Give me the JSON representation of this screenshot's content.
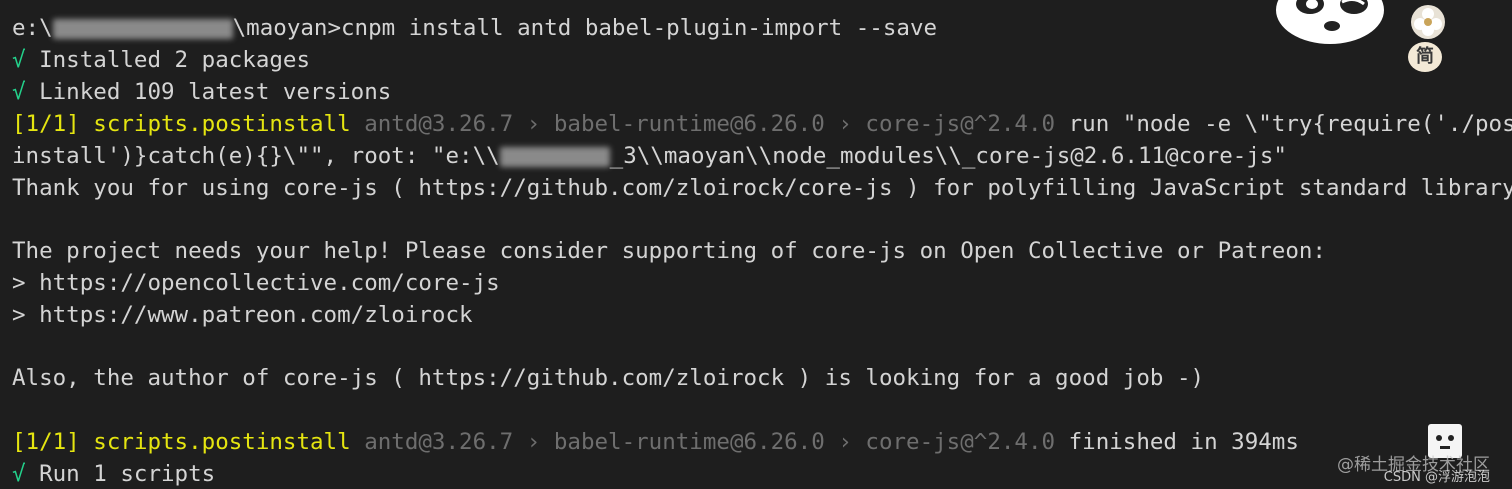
{
  "terminal": {
    "line1": {
      "prefix": "e:\\",
      "suffix": "\\maoyan>cnpm install antd babel-plugin-import --save"
    },
    "line2": {
      "check": "√",
      "text": " Installed 2 packages"
    },
    "line3": {
      "check": "√",
      "text": " Linked 109 latest versions"
    },
    "line4": {
      "tag": "[1/1] scripts.postinstall",
      "path": " antd@3.26.7 › babel-runtime@6.26.0 › core-js@^2.4.0",
      "cmd": " run \"node -e \\\"try{require('./post"
    },
    "line5": {
      "prefix": "install')}catch(e){}\\\"\", root: \"e:\\\\",
      "suffix": "_3\\\\maoyan\\\\node_modules\\\\_core-js@2.6.11@core-js\""
    },
    "line6": "Thank you for using core-js ( https://github.com/zloirock/core-js ) for polyfilling JavaScript standard library!",
    "line7": "The project needs your help! Please consider supporting of core-js on Open Collective or Patreon:",
    "line8": "> https://opencollective.com/core-js",
    "line9": "> https://www.patreon.com/zloirock",
    "line10": "Also, the author of core-js ( https://github.com/zloirock ) is looking for a good job -)",
    "line11": {
      "tag": "[1/1] scripts.postinstall",
      "path": " antd@3.26.7 › babel-runtime@6.26.0 › core-js@^2.4.0",
      "cmd": " finished in 394ms"
    },
    "line12": {
      "check": "√",
      "text": " Run 1 scripts"
    }
  },
  "overlay": {
    "jian_badge": "简",
    "watermark_main": "@稀土掘金技术社区",
    "watermark_sub": "CSDN @浮游泡泡"
  },
  "colors": {
    "background": "#1e1e1e",
    "text": "#d4d4d4",
    "success": "#23d18b",
    "script_tag": "#e5e510",
    "dim_path": "#6e6e6e"
  }
}
